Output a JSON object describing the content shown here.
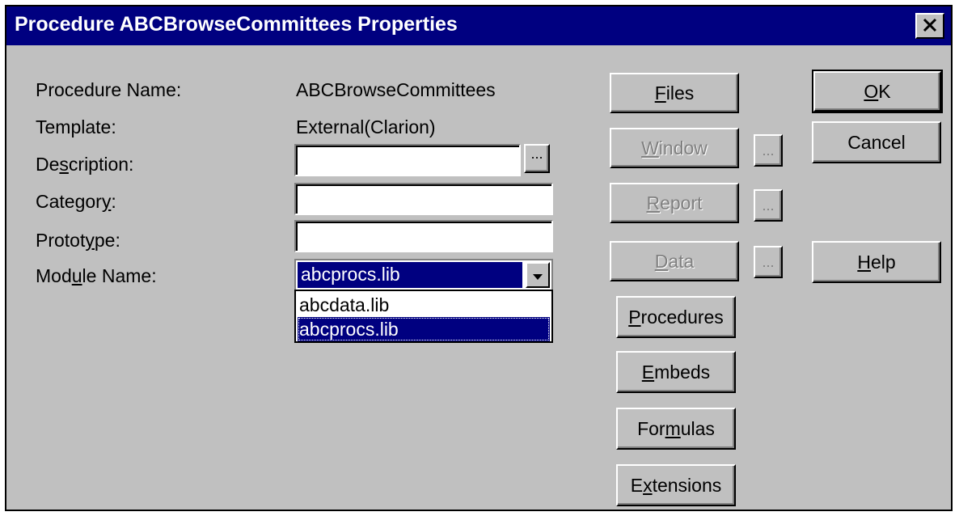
{
  "window": {
    "title": "Procedure ABCBrowseCommittees Properties",
    "close_icon": "close-icon"
  },
  "form": {
    "procedure_name_label": "Procedure Name:",
    "procedure_name_value": "ABCBrowseCommittees",
    "template_label": "Template:",
    "template_value": "External(Clarion)",
    "description_label_pre": "De",
    "description_label_ul": "s",
    "description_label_post": "cription:",
    "description_value": "",
    "category_label_pre": "Categor",
    "category_label_ul": "y",
    "category_label_post": ":",
    "category_value": "",
    "prototype_label_pre": "Protot",
    "prototype_label_ul": "y",
    "prototype_label_post": "pe:",
    "prototype_value": "",
    "module_label_pre": "Mod",
    "module_label_ul": "u",
    "module_label_post": "le Name:",
    "module_selected": "abcprocs.lib",
    "module_options": [
      "abcdata.lib",
      "abcprocs.lib"
    ],
    "ellipsis": "..."
  },
  "buttons": {
    "files_ul": "F",
    "files_rest": "iles",
    "window_ul": "W",
    "window_rest": "indow",
    "report_ul": "R",
    "report_rest": "eport",
    "data_ul": "D",
    "data_rest": "ata",
    "procedures_ul": "P",
    "procedures_rest": "rocedures",
    "embeds_ul": "E",
    "embeds_rest": "mbeds",
    "formulas_pre": "For",
    "formulas_ul": "m",
    "formulas_post": "ulas",
    "extensions_pre": "E",
    "extensions_ul": "x",
    "extensions_post": "tensions",
    "ok_ul": "O",
    "ok_rest": "K",
    "cancel": "Cancel",
    "help_ul": "H",
    "help_rest": "elp"
  },
  "colors": {
    "titlebar": "#000080",
    "face": "#c0c0c0",
    "selection": "#000080"
  }
}
